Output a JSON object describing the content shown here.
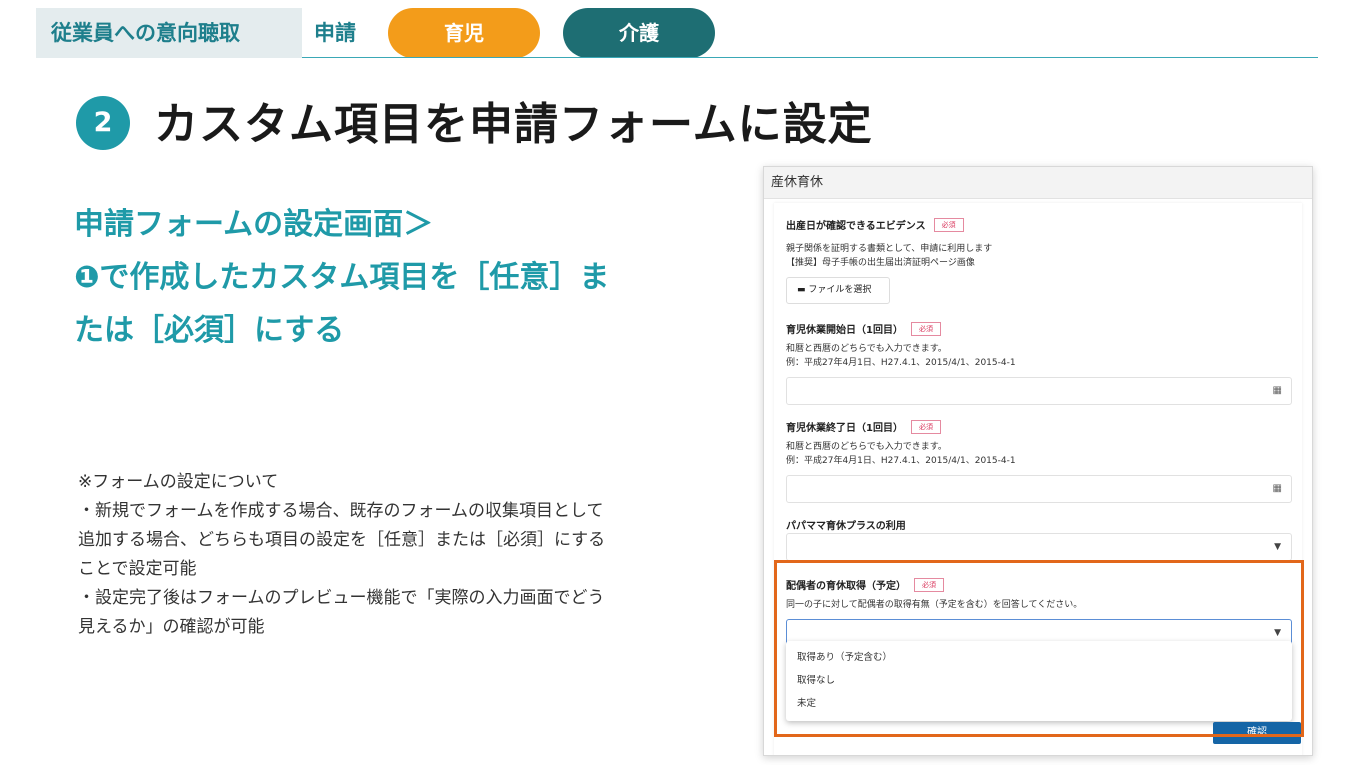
{
  "header": {
    "section": "従業員への意向聴取",
    "sub": "申請",
    "tabs": [
      {
        "label": "育児",
        "color": "#f39c1a"
      },
      {
        "label": "介護",
        "color": "#1e6e73"
      }
    ]
  },
  "title": {
    "step": "2",
    "text": "カスタム項目を申請フォームに設定"
  },
  "lead": {
    "lines": [
      "申請フォームの設定画面＞",
      "❶で作成したカスタム項目を［任意］ま",
      "たは［必須］にする"
    ]
  },
  "notes": {
    "lines": [
      "※フォームの設定について",
      "・新規でフォームを作成する場合、既存のフォームの収集項目として",
      "追加する場合、どちらも項目の設定を［任意］または［必須］にする",
      "ことで設定可能",
      "・設定完了後はフォームのプレビュー機能で「実際の入力画面でどう",
      "見えるか」の確認が可能"
    ]
  },
  "form": {
    "title": "産休育休",
    "required_badge": "必須",
    "evidence": {
      "label": "出産日が確認できるエビデンス",
      "desc1": "親子関係を証明する書類として、申請に利用します",
      "desc2": "【推奨】母子手帳の出生届出済証明ページ画像",
      "button": "ファイルを選択"
    },
    "start": {
      "label": "育児休業開始日（1回目）",
      "desc1": "和暦と西暦のどちらでも入力できます。",
      "desc2": "例：平成27年4月1日、H27.4.1、2015/4/1、2015-4-1"
    },
    "end": {
      "label": "育児休業終了日（1回目）",
      "desc1": "和暦と西暦のどちらでも入力できます。",
      "desc2": "例：平成27年4月1日、H27.4.1、2015/4/1、2015-4-1"
    },
    "papa": {
      "label": "パパママ育休プラスの利用"
    },
    "spouse": {
      "label": "配偶者の育休取得（予定）",
      "desc": "同一の子に対して配偶者の取得有無（予定を含む）を回答してください。",
      "options": [
        "取得あり（予定含む）",
        "取得なし",
        "未定"
      ]
    },
    "confirm": "確認"
  },
  "colors": {
    "accent": "#1f9aa8",
    "highlight": "#e2671a",
    "required": "#d9355b"
  }
}
